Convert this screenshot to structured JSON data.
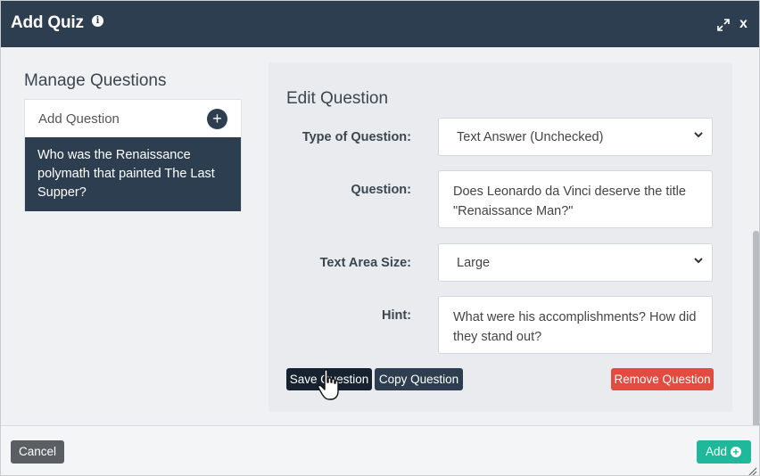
{
  "dialog": {
    "title": "Add Quiz",
    "close_label": "x"
  },
  "sidebar": {
    "title": "Manage Questions",
    "add_label": "Add Question",
    "add_symbol": "+",
    "questions": [
      {
        "text": "Who was the Renaissance polymath that painted The Last Supper?"
      }
    ]
  },
  "editor": {
    "title": "Edit Question",
    "type": {
      "label": "Type of Question:",
      "value": "Text Answer (Unchecked)"
    },
    "question": {
      "label": "Question:",
      "value": "Does Leonardo da Vinci deserve the title \"Renaissance Man?\""
    },
    "size": {
      "label": "Text Area Size:",
      "value": "Large"
    },
    "hint": {
      "label": "Hint:",
      "value": "What were his accomplishments? How did they stand out?"
    },
    "buttons": {
      "save": "Save Question",
      "copy": "Copy Question",
      "remove": "Remove Question"
    }
  },
  "footer": {
    "cancel": "Cancel",
    "add": "Add"
  },
  "colors": {
    "header": "#2d3e50",
    "selected_item": "#2d3e50",
    "remove": "#e24b3f",
    "add": "#1fb89a",
    "cancel": "#5b5f63"
  },
  "icons": [
    "info-icon",
    "expand-icon",
    "close-icon",
    "plus-icon",
    "chevron-down-icon",
    "hand-cursor-icon",
    "plus-circle-icon",
    "resize-grip-icon"
  ]
}
